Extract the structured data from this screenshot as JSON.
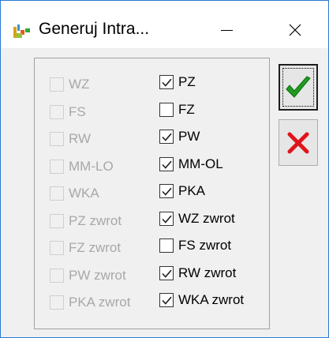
{
  "window": {
    "title": "Generuj Intra..."
  },
  "left_column": [
    {
      "label": "WZ",
      "checked": false,
      "enabled": false
    },
    {
      "label": "FS",
      "checked": false,
      "enabled": false
    },
    {
      "label": "RW",
      "checked": false,
      "enabled": false
    },
    {
      "label": "MM-LO",
      "checked": false,
      "enabled": false
    },
    {
      "label": "WKA",
      "checked": false,
      "enabled": false
    },
    {
      "label": "PZ zwrot",
      "checked": false,
      "enabled": false
    },
    {
      "label": "FZ zwrot",
      "checked": false,
      "enabled": false
    },
    {
      "label": "PW zwrot",
      "checked": false,
      "enabled": false
    },
    {
      "label": "PKA zwrot",
      "checked": false,
      "enabled": false
    }
  ],
  "right_column": [
    {
      "label": "PZ",
      "checked": true,
      "enabled": true
    },
    {
      "label": "FZ",
      "checked": false,
      "enabled": true
    },
    {
      "label": "PW",
      "checked": true,
      "enabled": true
    },
    {
      "label": "MM-OL",
      "checked": true,
      "enabled": true
    },
    {
      "label": "PKA",
      "checked": true,
      "enabled": true
    },
    {
      "label": "WZ zwrot",
      "checked": true,
      "enabled": true
    },
    {
      "label": "FS zwrot",
      "checked": false,
      "enabled": true
    },
    {
      "label": "RW zwrot",
      "checked": true,
      "enabled": true
    },
    {
      "label": "WKA zwrot",
      "checked": true,
      "enabled": true
    }
  ],
  "buttons": {
    "ok_icon": "green-check-icon",
    "cancel_icon": "red-x-icon"
  },
  "colors": {
    "window_border": "#2b79d7",
    "check_green": "#1f9c1f",
    "cancel_red": "#e0141a"
  }
}
